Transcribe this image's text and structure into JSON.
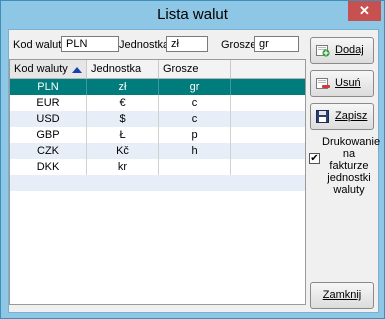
{
  "window": {
    "title": "Lista walut",
    "close_glyph": "✕"
  },
  "filters": {
    "code_label": "Kod waluty:",
    "code_value": "PLN",
    "unit_label": "Jednostka:",
    "unit_value": "zł",
    "cents_label": "Grosze:",
    "cents_value": "gr"
  },
  "table": {
    "columns": [
      "Kod waluty",
      "Jednostka",
      "Grosze"
    ],
    "sorted_column": "Kod waluty",
    "sort_direction": "ascending",
    "rows": [
      {
        "code": "PLN",
        "unit": "zł",
        "cents": "gr",
        "selected": true
      },
      {
        "code": "EUR",
        "unit": "€",
        "cents": "c"
      },
      {
        "code": "USD",
        "unit": "$",
        "cents": "c"
      },
      {
        "code": "GBP",
        "unit": "Ł",
        "cents": "p"
      },
      {
        "code": "CZK",
        "unit": "Kč",
        "cents": "h"
      },
      {
        "code": "DKK",
        "unit": "kr",
        "cents": ""
      }
    ]
  },
  "buttons": {
    "add": "Dodaj",
    "add_icon": "add-currency-icon",
    "delete": "Usuń",
    "delete_icon": "remove-icon",
    "save": "Zapisz",
    "save_icon": "floppy-disk-icon",
    "close": "Zamknij"
  },
  "options": {
    "print_on_invoice_label": "Drukowanie na fakturze jednostki waluty",
    "print_on_invoice_checked": true,
    "check_glyph": "✔"
  },
  "colors": {
    "selection": "#007c7c",
    "window_frame": "#8ec6e6",
    "close_button": "#c75050"
  }
}
